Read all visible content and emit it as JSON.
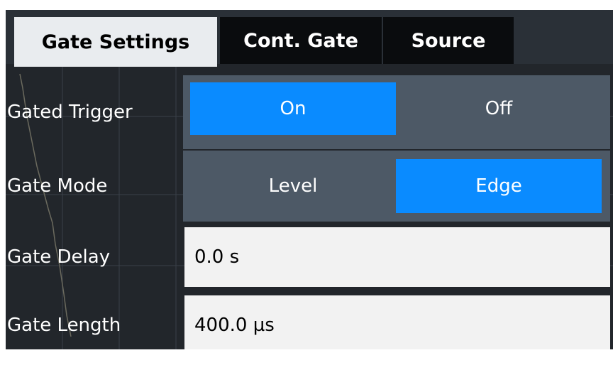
{
  "tabs": [
    {
      "label": "Gate Settings",
      "active": true
    },
    {
      "label": "Cont. Gate",
      "active": false
    },
    {
      "label": "Source",
      "active": false
    }
  ],
  "gated_trigger": {
    "label": "Gated Trigger",
    "options": [
      "On",
      "Off"
    ],
    "selected": "On"
  },
  "gate_mode": {
    "label": "Gate Mode",
    "options": [
      "Level",
      "Edge"
    ],
    "selected": "Edge"
  },
  "gate_delay": {
    "label": "Gate Delay",
    "value": "0.0 s"
  },
  "gate_length": {
    "label": "Gate Length",
    "value": "400.0 µs"
  },
  "colors": {
    "panel_bg": "#22262b",
    "toggle_bg": "#4d5966",
    "selected_blue": "#0a8bff",
    "field_bg": "#f2f2f2",
    "active_tab_bg": "#e9ecef"
  }
}
